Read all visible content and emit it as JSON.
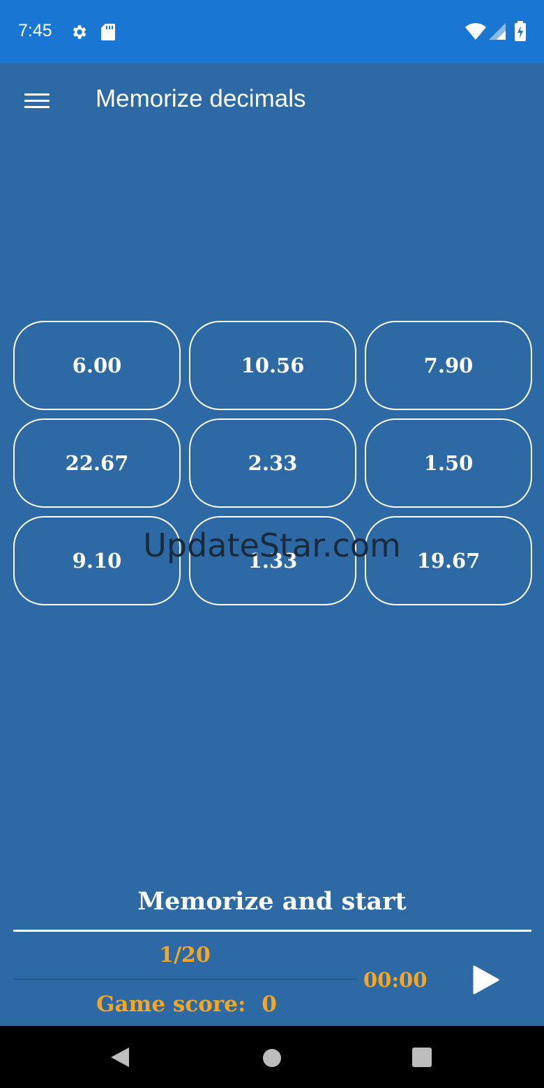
{
  "status_bar": {
    "time": "7:45",
    "icons": [
      "gear-icon",
      "sd-card-icon",
      "wifi-icon",
      "signal-icon",
      "battery-charging-icon"
    ]
  },
  "app_bar": {
    "title": "Memorize decimals",
    "menu_icon": "hamburger-menu-icon"
  },
  "grid": {
    "tiles": [
      "6.00",
      "10.56",
      "7.90",
      "22.67",
      "2.33",
      "1.50",
      "9.10",
      "1.33",
      "19.67"
    ]
  },
  "watermark": "UpdateStar.com",
  "footer": {
    "prompt": "Memorize and start",
    "progress": "1/20",
    "timer": "00:00",
    "score_label": "Game score:",
    "score_value": "0",
    "play_icon": "play-icon"
  },
  "nav_bar": {
    "icons": [
      "back-triangle-icon",
      "home-circle-icon",
      "recents-square-icon"
    ]
  },
  "colors": {
    "background": "#2d6aa5",
    "status_bar": "#1976d2",
    "accent": "#f5a623",
    "tile_border": "#ffffff"
  }
}
